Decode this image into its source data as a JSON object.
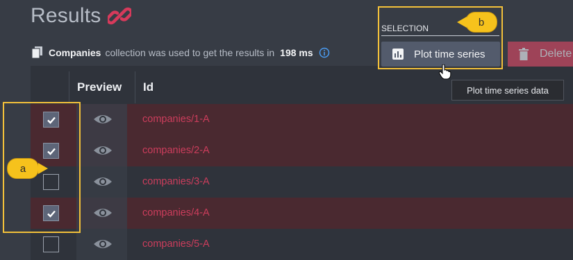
{
  "header": {
    "title": "Results",
    "link_icon": "link-icon"
  },
  "info": {
    "collection_name": "Companies",
    "text_collection": "collection",
    "text_used": "was used to get the results in",
    "duration": "198 ms"
  },
  "selection": {
    "label": "SELECTION",
    "plot_button_label": "Plot time series",
    "delete_button_label": "Delete",
    "tooltip": "Plot time series data"
  },
  "table": {
    "columns": [
      "Preview",
      "Id"
    ],
    "rows": [
      {
        "id": "companies/1-A",
        "checked": true
      },
      {
        "id": "companies/2-A",
        "checked": true
      },
      {
        "id": "companies/3-A",
        "checked": false
      },
      {
        "id": "companies/4-A",
        "checked": true
      },
      {
        "id": "companies/5-A",
        "checked": false
      }
    ]
  },
  "callouts": {
    "a": "a",
    "b": "b"
  },
  "colors": {
    "accent": "#f3c13a",
    "link": "#cc3d5c",
    "selected_row": "#4a2930",
    "delete": "#b0455c"
  }
}
